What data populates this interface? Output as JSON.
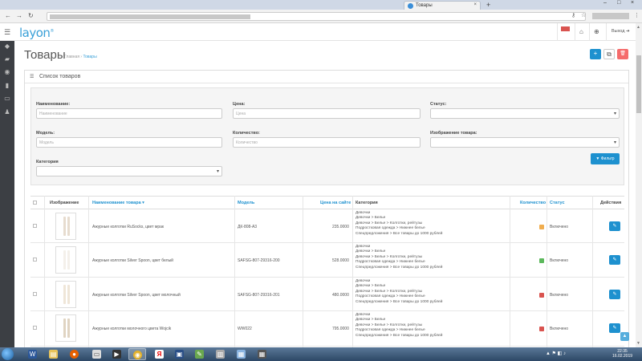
{
  "browser": {
    "tab_title": "Товары",
    "tab_close": "×",
    "new_tab": "+",
    "window_controls": [
      "–",
      "□",
      "×"
    ],
    "nav_icons": [
      "back-icon",
      "forward-icon",
      "reload-icon",
      "lock-icon"
    ],
    "back": "←",
    "forward": "→",
    "reload": "↻",
    "key_icon": "⚷",
    "star_icon": "☆",
    "menu_icon": "⋮"
  },
  "header": {
    "menu_icon": "☰",
    "logo": "layon",
    "home_icon": "⌂",
    "globe_icon": "⊕",
    "logout": "Выход ➔"
  },
  "page": {
    "title": "Товары",
    "breadcrumb_home": "Главная",
    "breadcrumb_sep": "›",
    "breadcrumb_current": "Товары",
    "add_icon": "+",
    "copy_icon": "⧉",
    "delete_icon": "🗑",
    "add_color": "#1e91cf",
    "copy_color": "#ffffff",
    "delete_color": "#f56b6b"
  },
  "panel": {
    "icon": "☰",
    "title": "Список товаров"
  },
  "filter": {
    "name_label": "Наименование:",
    "name_placeholder": "Наименование",
    "price_label": "Цена:",
    "price_placeholder": "Цена",
    "status_label": "Статус:",
    "model_label": "Модель:",
    "model_placeholder": "Модель",
    "quantity_label": "Количество:",
    "quantity_placeholder": "Количество",
    "image_label": "Изображение товара:",
    "category_label": "Категория",
    "button": "▼ Фильтр"
  },
  "table": {
    "headers": {
      "image": "Изображение",
      "name": "Наименование товара ▾",
      "model": "Модель",
      "price": "Цена на сайте",
      "category": "Категория",
      "quantity": "Количество",
      "status": "Статус",
      "actions": "Действия"
    },
    "rows": [
      {
        "name": "Ажурные колготки RuSocks, цвет мрак",
        "model": "ДК-808-А3",
        "price": "235.0000",
        "categories": [
          "Девочки",
          "Девочки  >  Белье",
          "Девочки  >  Белье  >  Колготки, рейтузы",
          "Подростковая одежда  >  Нижнее белье",
          "Спецпредложения  >  Все товары до 1000 рублей"
        ],
        "qty_color": "#f0ad4e",
        "status": "Включено"
      },
      {
        "name": "Ажурные колготки Silver Spoon, цвет белый",
        "model": "SAFSG-807-29316-200",
        "price": "528.0000",
        "categories": [
          "Девочки",
          "Девочки  >  Белье",
          "Девочки  >  Белье  >  Колготки, рейтузы",
          "Подростковая одежда  >  Нижнее белье",
          "Спецпредложения  >  Все товары до 1000 рублей"
        ],
        "qty_color": "#5cb85c",
        "status": "Включено"
      },
      {
        "name": "Ажурные колготки Silver Spoon, цвет молочный",
        "model": "SAFSG-807-29316-201",
        "price": "480.0000",
        "categories": [
          "Девочки",
          "Девочки  >  Белье",
          "Девочки  >  Белье  >  Колготки, рейтузы",
          "Подростковая одежда  >  Нижнее белье",
          "Спецпредложения  >  Все товары до 1000 рублей"
        ],
        "qty_color": "#d9534f",
        "status": "Включено"
      },
      {
        "name": "Ажурные колготки молочного цвета Wojcik",
        "model": "WW022",
        "price": "795.0000",
        "categories": [
          "Девочки",
          "Девочки  >  Белье",
          "Девочки  >  Белье  >  Колготки, рейтузы",
          "Подростковая одежда  >  Нижнее белье",
          "Спецпредложения  >  Все товары до 1000 рублей"
        ],
        "qty_color": "#d9534f",
        "status": "Включено"
      }
    ],
    "edit_icon": "✎"
  },
  "taskbar": {
    "clock_time": "22:35",
    "clock_date": "16.02.2019",
    "tray_icons": "▲ ⚑ ◧ ♪"
  },
  "scroll": {
    "up": "▲",
    "down": "▼",
    "to_top": "▲"
  }
}
